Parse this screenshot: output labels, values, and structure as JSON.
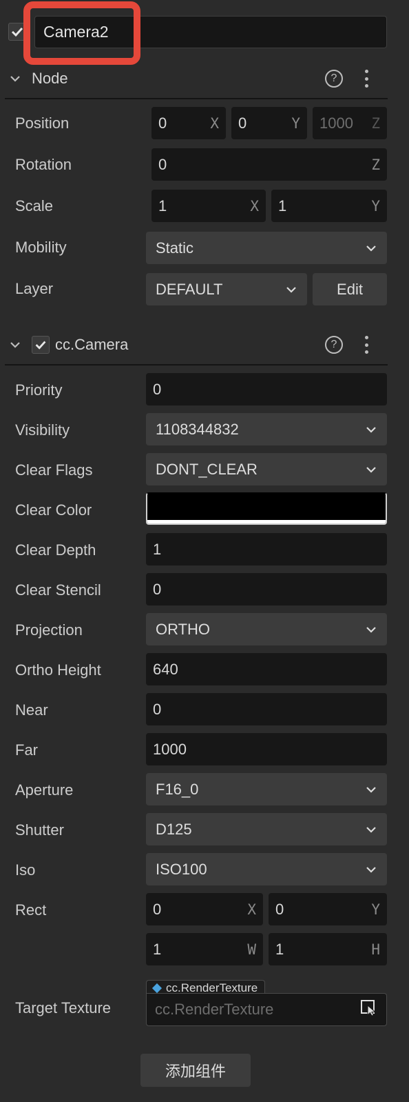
{
  "node_name": "Camera2",
  "node_section": {
    "title": "Node"
  },
  "position": {
    "label": "Position",
    "x": "0",
    "y": "0",
    "z": "1000",
    "x_axis": "X",
    "y_axis": "Y",
    "z_axis": "Z"
  },
  "rotation": {
    "label": "Rotation",
    "z": "0",
    "z_axis": "Z"
  },
  "scale": {
    "label": "Scale",
    "x": "1",
    "y": "1",
    "x_axis": "X",
    "y_axis": "Y"
  },
  "mobility": {
    "label": "Mobility",
    "value": "Static"
  },
  "layer": {
    "label": "Layer",
    "value": "DEFAULT",
    "edit_label": "Edit"
  },
  "camera_section": {
    "title": "cc.Camera"
  },
  "props": {
    "priority": {
      "label": "Priority",
      "value": "0"
    },
    "visibility": {
      "label": "Visibility",
      "value": "1108344832"
    },
    "clear_flags": {
      "label": "Clear Flags",
      "value": "DONT_CLEAR"
    },
    "clear_color": {
      "label": "Clear Color",
      "color": "#000000"
    },
    "clear_depth": {
      "label": "Clear Depth",
      "value": "1"
    },
    "clear_stencil": {
      "label": "Clear Stencil",
      "value": "0"
    },
    "projection": {
      "label": "Projection",
      "value": "ORTHO"
    },
    "ortho_height": {
      "label": "Ortho Height",
      "value": "640"
    },
    "near": {
      "label": "Near",
      "value": "0"
    },
    "far": {
      "label": "Far",
      "value": "1000"
    },
    "aperture": {
      "label": "Aperture",
      "value": "F16_0"
    },
    "shutter": {
      "label": "Shutter",
      "value": "D125"
    },
    "iso": {
      "label": "Iso",
      "value": "ISO100"
    }
  },
  "rect": {
    "label": "Rect",
    "x": "0",
    "y": "0",
    "w": "1",
    "h": "1",
    "x_axis": "X",
    "y_axis": "Y",
    "w_axis": "W",
    "h_axis": "H"
  },
  "target_texture": {
    "label": "Target Texture",
    "type_tag": "cc.RenderTexture",
    "placeholder": "cc.RenderTexture"
  },
  "add_component_label": "添加组件",
  "colors": {
    "background": "#2b2b2b",
    "field": "#171717",
    "select": "#3c3c3c",
    "highlight": "#e5483a",
    "asset_accent": "#4aa3df"
  }
}
